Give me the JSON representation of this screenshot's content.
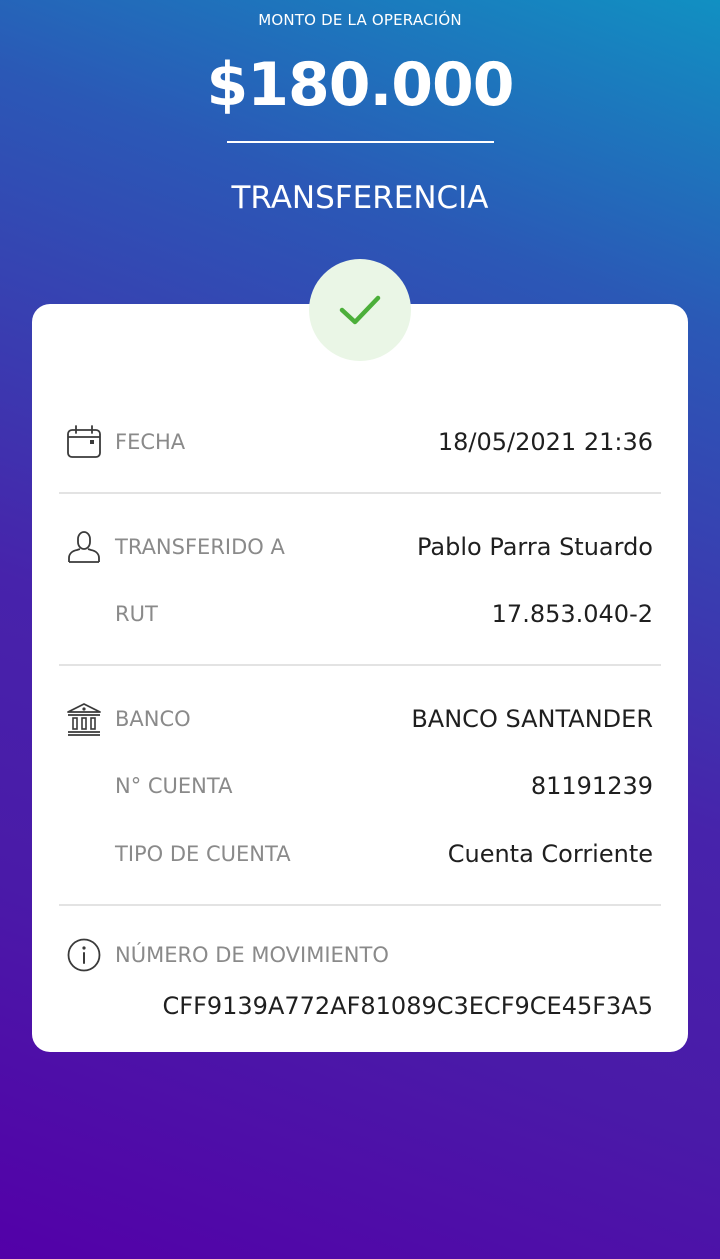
{
  "header": {
    "amount_caption": "MONTO DE LA OPERACIÓN",
    "amount": "$180.000",
    "operation_type": "TRANSFERENCIA"
  },
  "status": {
    "icon": "checkmark-icon",
    "color": "#4caf3a",
    "background": "#eaf6e6"
  },
  "details": {
    "date": {
      "icon": "calendar-icon",
      "label": "FECHA",
      "value": "18/05/2021 21:36"
    },
    "recipient": {
      "icon": "user-icon",
      "label": "TRANSFERIDO A",
      "value": "Pablo Parra Stuardo"
    },
    "rut": {
      "label": "RUT",
      "value": "17.853.040-2"
    },
    "bank": {
      "icon": "bank-icon",
      "label": "BANCO",
      "value": "BANCO SANTANDER"
    },
    "account_number": {
      "label": "N° CUENTA",
      "value": "81191239"
    },
    "account_type": {
      "label": "TIPO DE CUENTA",
      "value": "Cuenta Corriente"
    },
    "movement": {
      "icon": "info-icon",
      "label": "NÚMERO DE MOVIMIENTO",
      "value": "CFF9139A772AF81089C3ECF9CE45F3A5"
    }
  },
  "colors": {
    "gradient_top": "#1190c2",
    "gradient_bottom": "#5300a8",
    "card": "#ffffff",
    "label": "#8a8a8a",
    "value": "#1f1f1f"
  }
}
